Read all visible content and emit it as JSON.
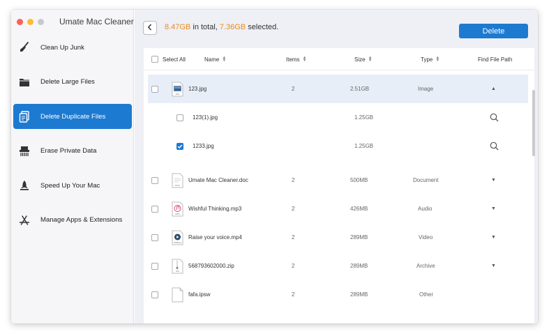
{
  "app": {
    "title": "Umate Mac Cleaner"
  },
  "sidebar": {
    "items": [
      {
        "label": "Clean Up Junk",
        "icon": "broom-icon"
      },
      {
        "label": "Delete Large Files",
        "icon": "folder-icon"
      },
      {
        "label": "Delete Duplicate Files",
        "icon": "duplicate-files-icon",
        "active": true
      },
      {
        "label": "Erase Private Data",
        "icon": "shredder-icon"
      },
      {
        "label": "Speed Up Your Mac",
        "icon": "rocket-icon"
      },
      {
        "label": "Manage Apps & Extensions",
        "icon": "app-store-icon"
      }
    ]
  },
  "summary": {
    "total": "8.47GB",
    "in_total": "in total,",
    "selected_size": "7.36GB",
    "selected": "selected."
  },
  "toolbar": {
    "delete_label": "Delete"
  },
  "table": {
    "headers": {
      "select_all": "Select All",
      "name": "Name",
      "items": "Items",
      "size": "Size",
      "type": "Type",
      "path": "Find File Path"
    },
    "rows": [
      {
        "name": "123.jpg",
        "items": "2",
        "size": "2.51GB",
        "type": "Image",
        "expanded": true
      },
      {
        "name": "123(1).jpg",
        "size": "1.25GB",
        "child": true,
        "checked": false
      },
      {
        "name": "1233.jpg",
        "size": "1.25GB",
        "child": true,
        "checked": true
      },
      {
        "name": "Umate Mac Cleaner.doc",
        "items": "2",
        "size": "500MB",
        "type": "Document"
      },
      {
        "name": "Wishful Thinking.mp3",
        "items": "2",
        "size": "426MB",
        "type": "Audio"
      },
      {
        "name": "Raise your voice.mp4",
        "items": "2",
        "size": "289MB",
        "type": "Video"
      },
      {
        "name": "568793602000.zip",
        "items": "2",
        "size": "289MB",
        "type": "Archive"
      },
      {
        "name": "fafa.ipsw",
        "items": "2",
        "size": "289MB",
        "type": "Other"
      }
    ]
  },
  "colors": {
    "accent": "#1d7ad1",
    "highlight": "#f08a1c"
  }
}
